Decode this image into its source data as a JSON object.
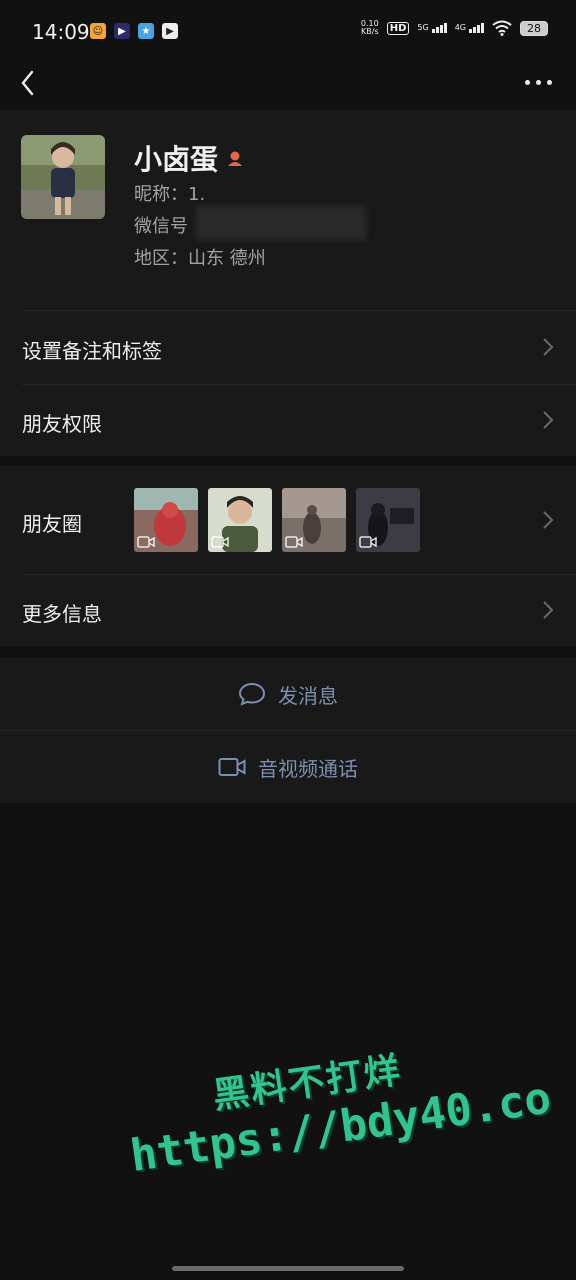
{
  "status_bar": {
    "time": "14:09",
    "net_speed_value": "0.10",
    "net_speed_unit": "KB/s",
    "hd": "HD",
    "sim1": "5G",
    "sim2": "4G",
    "battery": "28"
  },
  "profile": {
    "name": "小卤蛋",
    "nickname": "昵称：1.",
    "wechat_id": "微信号",
    "region": "地区：山东  德州"
  },
  "cells": {
    "remark_label": "设置备注和标签",
    "permission_label": "朋友权限",
    "moments_label": "朋友圈",
    "more_label": "更多信息"
  },
  "actions": {
    "message_label": "发消息",
    "call_label": "音视频通话"
  },
  "watermark": {
    "line1": "黑料不打烊",
    "line2": "https://bdy40.co"
  },
  "colors": {
    "background": "#111111",
    "panel": "#191919",
    "action_text": "#7d8fae",
    "watermark": "#34c38f"
  }
}
